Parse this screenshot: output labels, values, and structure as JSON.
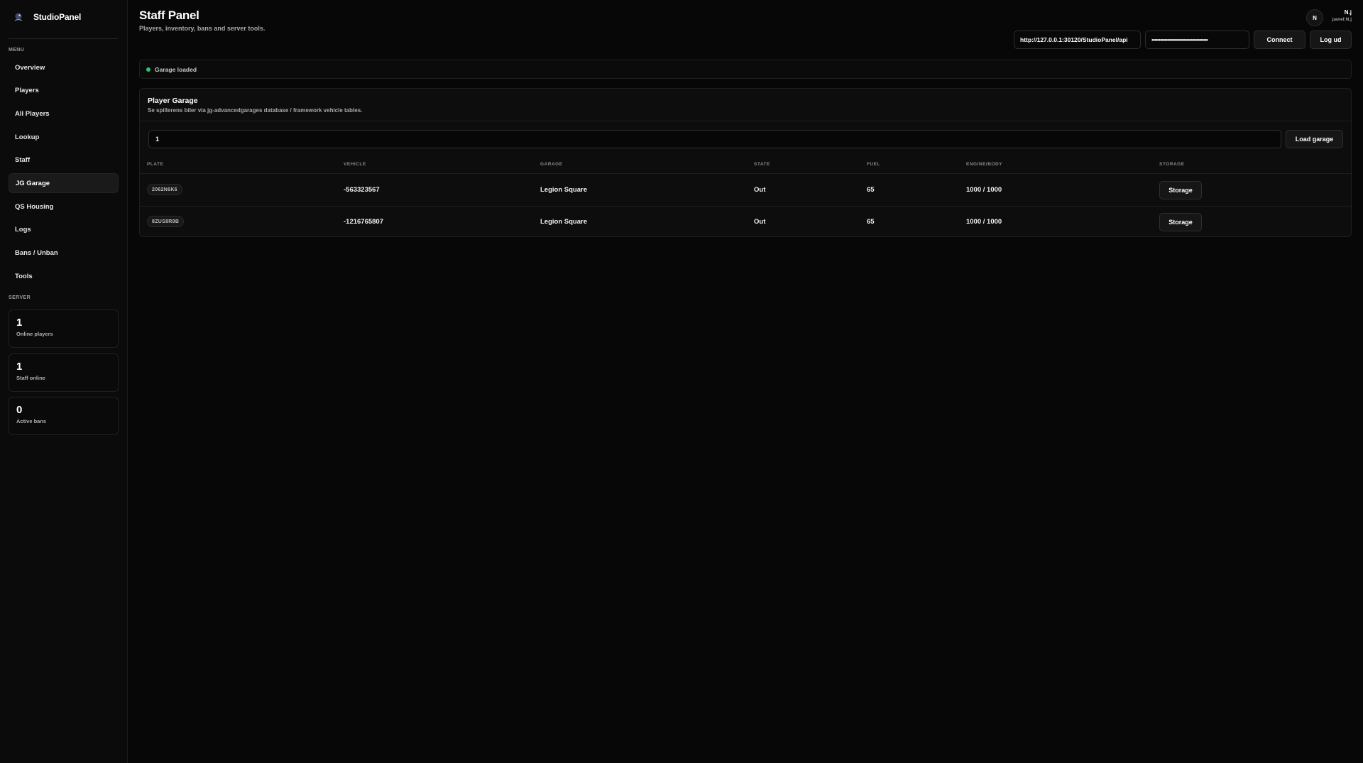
{
  "app": {
    "name": "StudioPanel"
  },
  "sidebar": {
    "menu_label": "MENU",
    "items": [
      {
        "label": "Overview",
        "active": false
      },
      {
        "label": "Players",
        "active": false
      },
      {
        "label": "All Players",
        "active": false
      },
      {
        "label": "Lookup",
        "active": false
      },
      {
        "label": "Staff",
        "active": false
      },
      {
        "label": "JG Garage",
        "active": true
      },
      {
        "label": "QS Housing",
        "active": false
      },
      {
        "label": "Logs",
        "active": false
      },
      {
        "label": "Bans / Unban",
        "active": false
      },
      {
        "label": "Tools",
        "active": false
      }
    ],
    "server_label": "SERVER",
    "stats": [
      {
        "value": "1",
        "label": "Online players"
      },
      {
        "value": "1",
        "label": "Staff online"
      },
      {
        "value": "0",
        "label": "Active bans"
      }
    ]
  },
  "header": {
    "title": "Staff Panel",
    "subtitle": "Players, inventory, bans and server tools.",
    "avatar_initial": "N",
    "user_name": "N.j",
    "user_sub": "panel:N.j",
    "api_url": "http://127.0.0.1:30120/StudioPanel/api",
    "token_masked": "••••••••••••••••••••••••••••••••••••••••",
    "connect_label": "Connect",
    "logout_label": "Log ud"
  },
  "status": {
    "text": "Garage loaded",
    "color": "#2ec477"
  },
  "garage": {
    "title": "Player Garage",
    "description": "Se spillerens biler via jg-advancedgarages database / framework vehicle tables.",
    "player_id": "1",
    "load_label": "Load garage",
    "columns": [
      "PLATE",
      "VEHICLE",
      "GARAGE",
      "STATE",
      "FUEL",
      "ENGINE/BODY",
      "STORAGE"
    ],
    "rows": [
      {
        "plate": "2062N6K6",
        "vehicle": "-563323567",
        "garage": "Legion Square",
        "state": "Out",
        "fuel": "65",
        "engine_body": "1000 / 1000",
        "storage_label": "Storage"
      },
      {
        "plate": "8ZUS8R9B",
        "vehicle": "-1216765807",
        "garage": "Legion Square",
        "state": "Out",
        "fuel": "65",
        "engine_body": "1000 / 1000",
        "storage_label": "Storage"
      }
    ]
  }
}
